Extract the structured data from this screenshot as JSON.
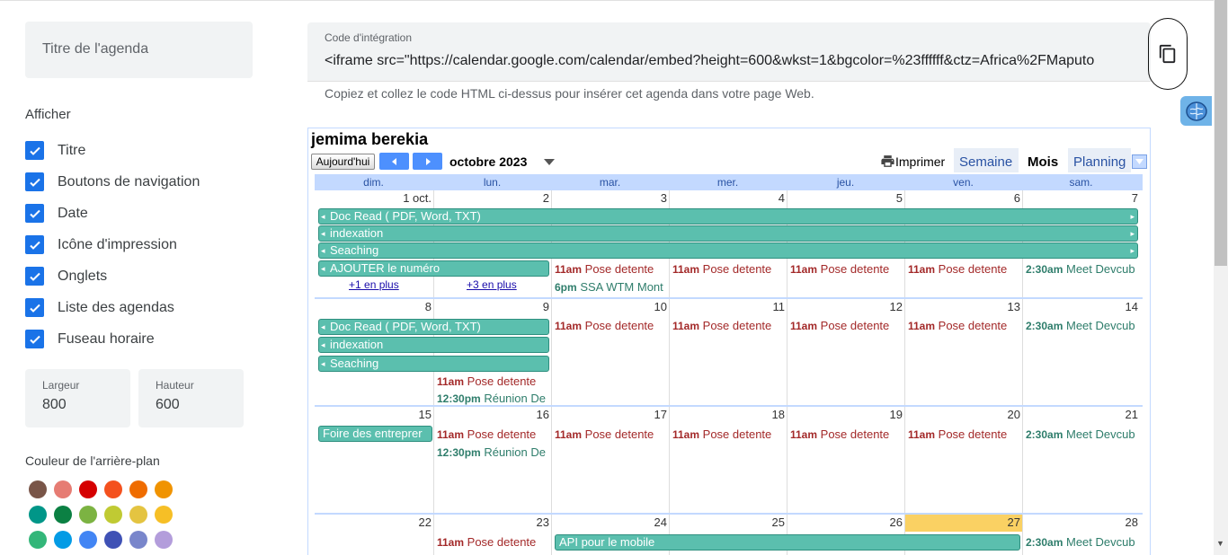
{
  "sidebar": {
    "title_placeholder": "Titre de l'agenda",
    "show_heading": "Afficher",
    "options": [
      {
        "label": "Titre",
        "checked": true
      },
      {
        "label": "Boutons de navigation",
        "checked": true
      },
      {
        "label": "Date",
        "checked": true
      },
      {
        "label": "Icône d'impression",
        "checked": true
      },
      {
        "label": "Onglets",
        "checked": true
      },
      {
        "label": "Liste des agendas",
        "checked": true
      },
      {
        "label": "Fuseau horaire",
        "checked": true
      }
    ],
    "width_label": "Largeur",
    "width_value": "800",
    "height_label": "Hauteur",
    "height_value": "600",
    "bg_color_label": "Couleur de l'arrière-plan",
    "colors": [
      "#795548",
      "#e67c73",
      "#d50000",
      "#f4511e",
      "#ef6c00",
      "#f09300",
      "#009688",
      "#0b8043",
      "#7cb342",
      "#c0ca33",
      "#e4c441",
      "#f6bf26",
      "#33b679",
      "#039be5",
      "#4285f4",
      "#3f51b5",
      "#7986cb",
      "#b39ddb"
    ]
  },
  "embed": {
    "label": "Code d'intégration",
    "code": "<iframe src=\"https://calendar.google.com/calendar/embed?height=600&wkst=1&bgcolor=%23ffffff&ctz=Africa%2FMaputo",
    "help": "Copiez et collez le code HTML ci-dessus pour insérer cet agenda dans votre page Web."
  },
  "calendar": {
    "title": "jemima berekia",
    "today_label": "Aujourd'hui",
    "month": "octobre 2023",
    "print_label": "Imprimer",
    "tabs": [
      "Semaine",
      "Mois",
      "Planning"
    ],
    "active_tab": "Mois",
    "weekdays": [
      "dim.",
      "lun.",
      "mar.",
      "mer.",
      "jeu.",
      "ven.",
      "sam."
    ],
    "weeks": [
      [
        "1 oct.",
        "2",
        "3",
        "4",
        "5",
        "6",
        "7"
      ],
      [
        "8",
        "9",
        "10",
        "11",
        "12",
        "13",
        "14"
      ],
      [
        "15",
        "16",
        "17",
        "18",
        "19",
        "20",
        "21"
      ],
      [
        "22",
        "23",
        "24",
        "25",
        "26",
        "27",
        "28"
      ]
    ],
    "today": "27",
    "events": {
      "doc_read": "Doc Read ( PDF, Word, TXT)",
      "indexation": "indexation",
      "seaching": "Seaching",
      "ajouter": "AJOUTER le numéro",
      "foire": "Foire des entreprer",
      "api": "API pour le mobile",
      "pose_time": "11am",
      "pose_title": "Pose detente",
      "meet_time": "2:30am",
      "meet_title": "Meet Devcub",
      "ssa_time": "6pm",
      "ssa_title": "SSA WTM Mont",
      "reunion_time": "12:30pm",
      "reunion_title": "Réunion De",
      "more1": "+1 en plus",
      "more3": "+3 en plus"
    }
  }
}
